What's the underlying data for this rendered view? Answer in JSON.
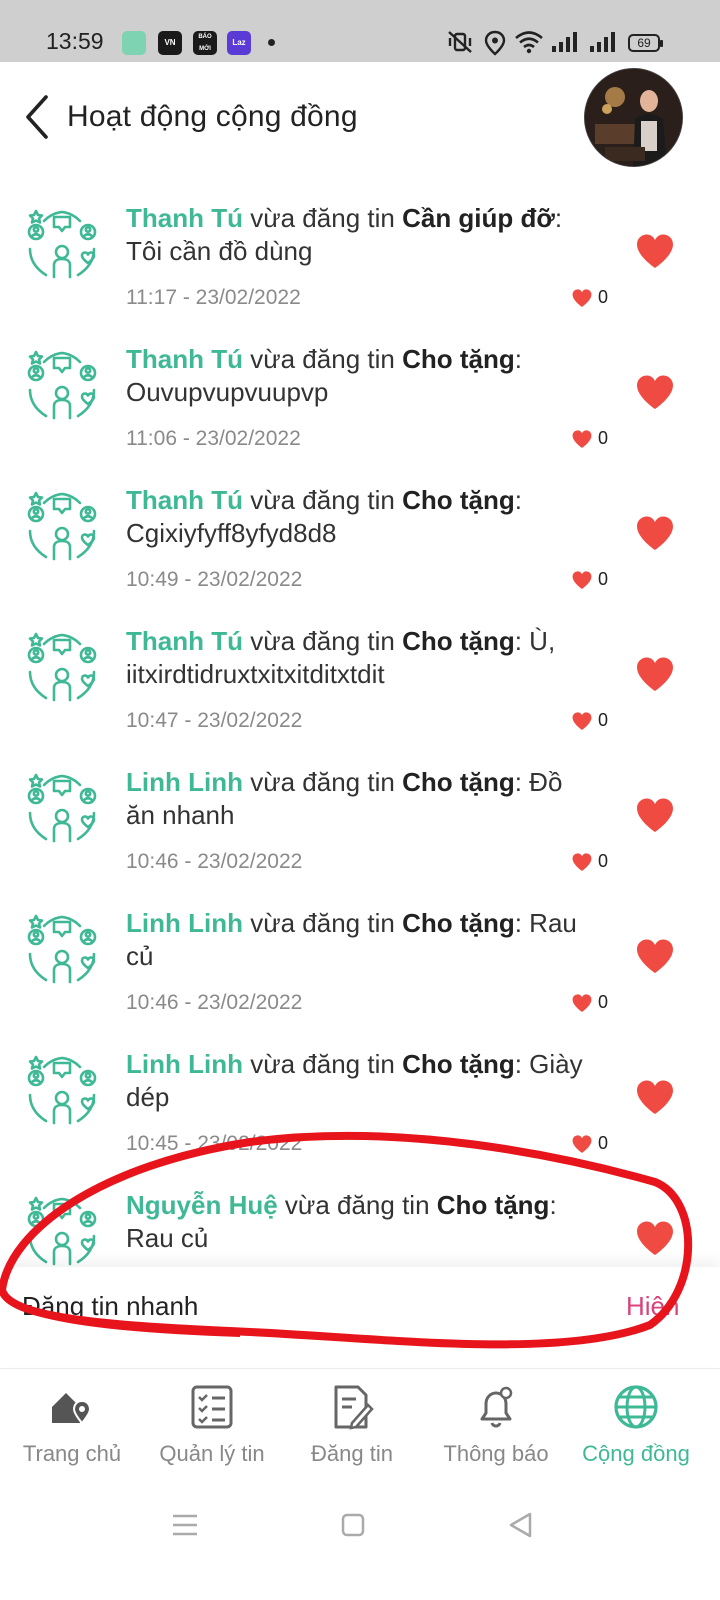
{
  "status_bar": {
    "time": "13:59",
    "apps": [
      {
        "name": "app-1-icon",
        "label": "",
        "color": "#7ed3b2"
      },
      {
        "name": "vn-app-icon",
        "label": "VN",
        "color": "#1a1a1a"
      },
      {
        "name": "bao-moi-icon",
        "label": "BÁO MỚI",
        "color": "#1a1a1a"
      },
      {
        "name": "lazada-icon",
        "label": "Laz",
        "color": "#5a3bd6"
      }
    ],
    "battery": "69"
  },
  "header": {
    "title": "Hoạt động cộng đồng"
  },
  "feed": {
    "posted_text": "vừa đăng tin",
    "items": [
      {
        "user": "Thanh Tú",
        "category": "Cần giúp đỡ",
        "content": ": Tôi cần đồ dùng",
        "time": "11:17 - 23/02/2022",
        "likes": "0"
      },
      {
        "user": "Thanh Tú",
        "category": "Cho tặng",
        "content": ": Ouvupvupvuupvp",
        "time": "11:06 - 23/02/2022",
        "likes": "0"
      },
      {
        "user": "Thanh Tú",
        "category": "Cho tặng",
        "content": ": Cgixiyfyff8yfyd8d8",
        "time": "10:49 - 23/02/2022",
        "likes": "0"
      },
      {
        "user": "Thanh Tú",
        "category": "Cho tặng",
        "content": ": Ù, iitxirdtidruxtxitxitditxtdit",
        "time": "10:47 - 23/02/2022",
        "likes": "0"
      },
      {
        "user": "Linh Linh",
        "category": "Cho tặng",
        "content": ": Đồ ăn nhanh",
        "time": "10:46 - 23/02/2022",
        "likes": "0"
      },
      {
        "user": "Linh Linh",
        "category": "Cho tặng",
        "content": ": Rau củ",
        "time": "10:46 - 23/02/2022",
        "likes": "0"
      },
      {
        "user": "Linh Linh",
        "category": "Cho tặng",
        "content": ": Giày dép",
        "time": "10:45 - 23/02/2022",
        "likes": "0"
      },
      {
        "user": "Nguyễn Huệ",
        "category": "Cho tặng",
        "content": ": Rau củ",
        "time": "",
        "likes": ""
      }
    ]
  },
  "quick_post": {
    "title": "Đăng tin nhanh",
    "action": "Hiện"
  },
  "bottom_nav": [
    {
      "key": "home",
      "label": "Trang chủ",
      "icon": "home-location-icon",
      "active": false
    },
    {
      "key": "manage",
      "label": "Quản lý tin",
      "icon": "checklist-icon",
      "active": false
    },
    {
      "key": "post",
      "label": "Đăng tin",
      "icon": "edit-document-icon",
      "active": false
    },
    {
      "key": "notify",
      "label": "Thông báo",
      "icon": "bell-icon",
      "active": false
    },
    {
      "key": "community",
      "label": "Cộng đồng",
      "icon": "globe-icon",
      "active": true
    }
  ],
  "colors": {
    "accent": "#3fb896",
    "like": "#f04b43",
    "quick_action": "#d9437a",
    "annotation": "#e8141c"
  }
}
